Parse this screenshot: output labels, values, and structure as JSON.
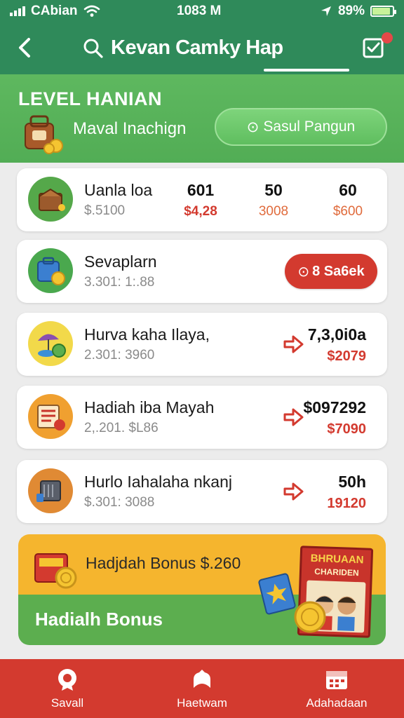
{
  "status_bar": {
    "carrier": "CAbian",
    "time": "1083 M",
    "battery": "89%",
    "battery_level": 0.89
  },
  "header": {
    "title": "Kevan Camky Hap",
    "notification_count": ""
  },
  "level": {
    "title": "LEVEL HANIAN",
    "subtitle": "Maval Inachign",
    "action_label": "Sasul Pangun",
    "action_prefix": "⊙"
  },
  "cards": [
    {
      "title": "Uanla loa",
      "subtitle": "$.5100",
      "stats": [
        {
          "top": "601",
          "bottom": "$4,28",
          "color": "#d33a2f"
        },
        {
          "top": "50",
          "bottom": "3008",
          "color": "#e06b3c"
        },
        {
          "top": "60",
          "bottom": "$600",
          "color": "#e06b3c"
        }
      ]
    },
    {
      "title": "Sevaplarn",
      "subtitle": "3.301: 1:.88",
      "button_label": "8 Sa6ek",
      "button_prefix": "⊙"
    },
    {
      "title": "Hurva kaha Ilaya,",
      "subtitle": "2.301: 3960",
      "value_top": "7,3,0i0a",
      "value_bottom": "$2079"
    },
    {
      "title": "Hadiah iba Mayah",
      "subtitle": "2,.201. $L86",
      "value_top": "$097292",
      "value_bottom": "$7090"
    },
    {
      "title": "Hurlo Iahalaha nkanj",
      "subtitle": "$.301: 3088",
      "value_top": "50h",
      "value_bottom": "19120"
    }
  ],
  "bonus": {
    "line": "Hadjdah Bonus  $.260",
    "title": "Hadialh Bonus",
    "book_title": "BHRUAAN",
    "book_sub": "CHARIDEN"
  },
  "bottom_nav": [
    {
      "label": "Savall"
    },
    {
      "label": "Haetwam"
    },
    {
      "label": "Adahadaan"
    }
  ]
}
